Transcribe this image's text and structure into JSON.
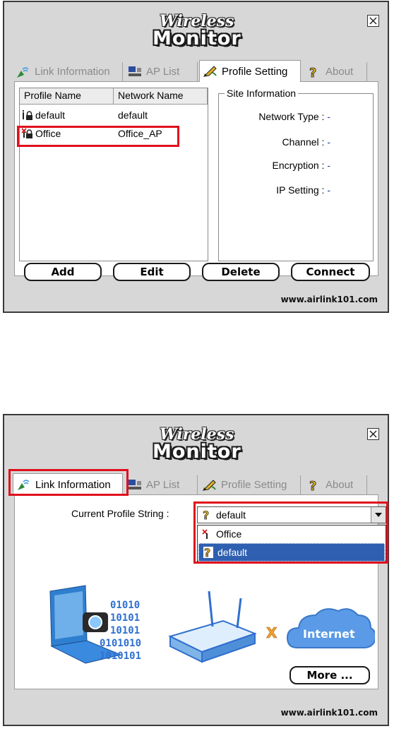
{
  "app": {
    "logo_line1": "Wireless",
    "logo_line2": "Monitor",
    "url": "www.airlink101.com"
  },
  "tabs": [
    {
      "label": "Link Information",
      "icon": "link-information-icon"
    },
    {
      "label": "AP List",
      "icon": "ap-list-icon"
    },
    {
      "label": "Profile Setting",
      "icon": "profile-setting-icon"
    },
    {
      "label": "About",
      "icon": "about-icon"
    }
  ],
  "profile_window": {
    "active_tab": "Profile Setting",
    "columns": [
      "Profile Name",
      "Network Name"
    ],
    "rows": [
      {
        "profile": "default",
        "network": "default"
      },
      {
        "profile": "Office",
        "network": "Office_AP",
        "highlighted": true
      }
    ],
    "site_info": {
      "title": "Site Information",
      "fields": [
        {
          "label": "Network Type :",
          "value": "-"
        },
        {
          "label": "Channel :",
          "value": "-"
        },
        {
          "label": "Encryption :",
          "value": "-"
        },
        {
          "label": "IP Setting :",
          "value": "-"
        }
      ]
    },
    "buttons": [
      "Add",
      "Edit",
      "Delete",
      "Connect"
    ]
  },
  "link_window": {
    "active_tab": "Link Information",
    "current_profile_label": "Current Profile String :",
    "dropdown_value": "default",
    "dropdown_options": [
      {
        "label": "Office",
        "selected": false
      },
      {
        "label": "default",
        "selected": true
      }
    ],
    "binary_text": [
      "01010",
      "10101",
      "10101",
      "0101010",
      "1010101"
    ],
    "status_symbol": "X",
    "cloud_label": "Internet",
    "more_button": "More ..."
  },
  "colors": {
    "highlight": "#e0101c",
    "window_bg": "#d7d7d7",
    "selection": "#2f5fb0",
    "value_text": "#1a3fb0"
  }
}
